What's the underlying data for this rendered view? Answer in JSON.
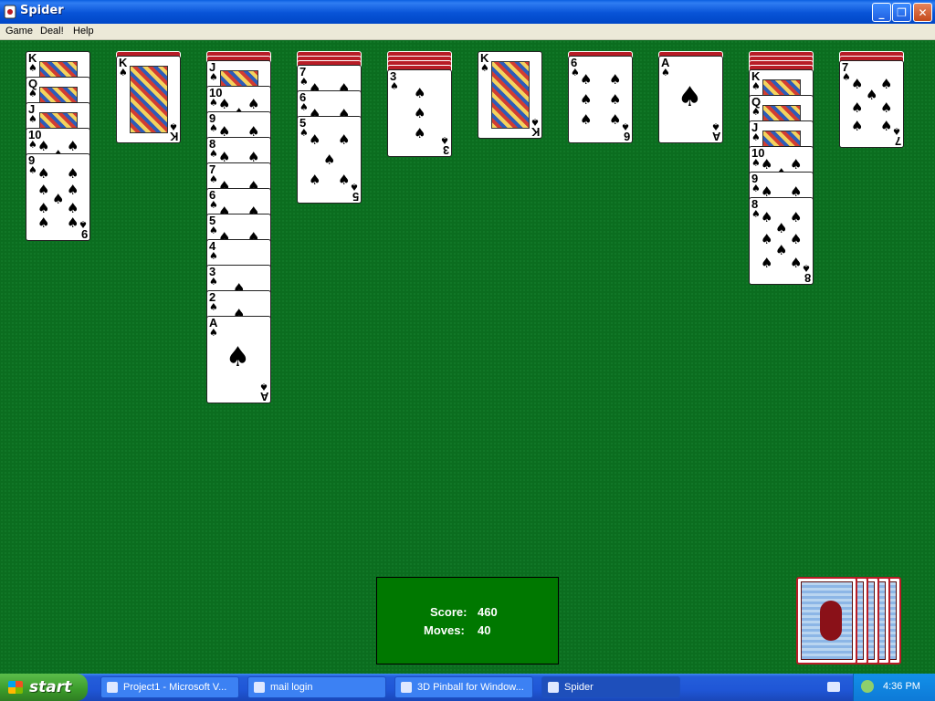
{
  "window": {
    "title": "Spider",
    "min_btn": "_",
    "max_btn": "❐",
    "close_btn": "✕"
  },
  "menu": {
    "items": [
      "Game",
      "Deal!",
      "Help"
    ]
  },
  "colors": {
    "table": "#0b6d1f",
    "card_back": "#b81c26",
    "score_bg": "#007800"
  },
  "columns": [
    {
      "backs": 0,
      "cards": [
        "K",
        "Q",
        "J",
        "10",
        "9"
      ]
    },
    {
      "backs": 1,
      "cards": [
        "K"
      ]
    },
    {
      "backs": 2,
      "cards": [
        "J",
        "10",
        "9",
        "8",
        "7",
        "6",
        "5",
        "4",
        "3",
        "2",
        "A"
      ]
    },
    {
      "backs": 3,
      "cards": [
        "7",
        "6",
        "5"
      ]
    },
    {
      "backs": 4,
      "cards": [
        "3"
      ]
    },
    {
      "backs": 0,
      "cards": [
        "K"
      ]
    },
    {
      "backs": 1,
      "cards": [
        "6"
      ]
    },
    {
      "backs": 1,
      "cards": [
        "A"
      ]
    },
    {
      "backs": 4,
      "cards": [
        "K",
        "Q",
        "J",
        "10",
        "9",
        "8"
      ]
    },
    {
      "backs": 2,
      "cards": [
        "7"
      ]
    }
  ],
  "suit": "♠",
  "score": {
    "score_label": "Score:",
    "score_value": "460",
    "moves_label": "Moves:",
    "moves_value": "40"
  },
  "stock": {
    "piles": 5
  },
  "taskbar": {
    "start": "start",
    "tasks": [
      "Project1 - Microsoft V...",
      "mail login",
      "3D Pinball for Window...",
      "Spider"
    ],
    "active_task": "Spider",
    "clock": "4:36 PM"
  }
}
